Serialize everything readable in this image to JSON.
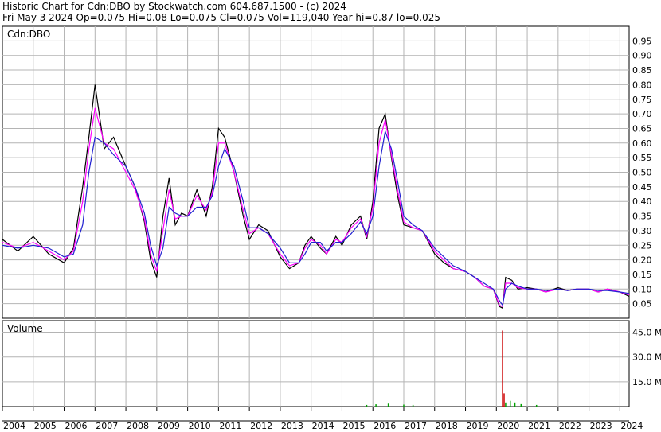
{
  "header": {
    "line1": "Historic Chart for Cdn:DBO by Stockwatch.com 604.687.1500 - (c) 2024",
    "line2": "Fri May  3 2024   Op=0.075   Hi=0.08   Lo=0.075   Cl=0.075   Vol=119,040   Year hi=0.87   lo=0.025"
  },
  "colors": {
    "price": "#000000",
    "ma_short": "#ff00ff",
    "ma_long": "#2020d0",
    "volume": "#cc0000",
    "volume_up": "#00a000",
    "grid": "#b4b4b4",
    "background": "#ffffff"
  },
  "chart_data": [
    {
      "type": "line",
      "legend": "Cdn:DBO",
      "ylim": [
        0,
        1.0
      ],
      "y_ticks": [
        "0.05",
        "0.10",
        "0.15",
        "0.20",
        "0.25",
        "0.30",
        "0.35",
        "0.40",
        "0.45",
        "0.50",
        "0.55",
        "0.60",
        "0.65",
        "0.70",
        "0.75",
        "0.80",
        "0.85",
        "0.90",
        "0.95"
      ],
      "grid": true,
      "x": [
        2004.0,
        2004.5,
        2005.0,
        2005.5,
        2006.0,
        2006.3,
        2006.6,
        2006.8,
        2007.0,
        2007.3,
        2007.6,
        2008.0,
        2008.3,
        2008.6,
        2008.8,
        2009.0,
        2009.2,
        2009.4,
        2009.6,
        2009.8,
        2010.0,
        2010.3,
        2010.6,
        2010.8,
        2011.0,
        2011.2,
        2011.5,
        2011.8,
        2012.0,
        2012.3,
        2012.6,
        2013.0,
        2013.3,
        2013.6,
        2013.8,
        2014.0,
        2014.3,
        2014.5,
        2014.8,
        2015.0,
        2015.3,
        2015.6,
        2015.8,
        2016.0,
        2016.2,
        2016.4,
        2016.6,
        2016.8,
        2017.0,
        2017.3,
        2017.6,
        2018.0,
        2018.3,
        2018.6,
        2019.0,
        2019.3,
        2019.6,
        2019.9,
        2020.1,
        2020.2,
        2020.3,
        2020.5,
        2020.7,
        2021.0,
        2021.3,
        2021.6,
        2022.0,
        2022.3,
        2022.6,
        2023.0,
        2023.3,
        2023.6,
        2024.0,
        2024.3
      ],
      "series": [
        {
          "values": [
            0.27,
            0.23,
            0.28,
            0.22,
            0.19,
            0.24,
            0.45,
            0.62,
            0.8,
            0.58,
            0.62,
            0.52,
            0.45,
            0.33,
            0.2,
            0.14,
            0.35,
            0.48,
            0.32,
            0.36,
            0.35,
            0.44,
            0.35,
            0.45,
            0.65,
            0.62,
            0.5,
            0.35,
            0.27,
            0.32,
            0.3,
            0.21,
            0.17,
            0.19,
            0.25,
            0.28,
            0.24,
            0.22,
            0.28,
            0.25,
            0.32,
            0.35,
            0.27,
            0.4,
            0.65,
            0.7,
            0.55,
            0.42,
            0.32,
            0.31,
            0.3,
            0.22,
            0.19,
            0.17,
            0.16,
            0.14,
            0.11,
            0.1,
            0.04,
            0.035,
            0.14,
            0.13,
            0.1,
            0.105,
            0.1,
            0.09,
            0.105,
            0.095,
            0.1,
            0.1,
            0.09,
            0.1,
            0.09,
            0.075
          ]
        },
        {
          "values": [
            0.26,
            0.24,
            0.26,
            0.23,
            0.2,
            0.23,
            0.4,
            0.58,
            0.72,
            0.6,
            0.58,
            0.5,
            0.44,
            0.34,
            0.22,
            0.16,
            0.3,
            0.44,
            0.34,
            0.35,
            0.35,
            0.42,
            0.37,
            0.43,
            0.6,
            0.6,
            0.5,
            0.37,
            0.29,
            0.31,
            0.29,
            0.22,
            0.18,
            0.19,
            0.24,
            0.27,
            0.25,
            0.22,
            0.27,
            0.26,
            0.31,
            0.34,
            0.28,
            0.38,
            0.6,
            0.68,
            0.56,
            0.44,
            0.33,
            0.31,
            0.3,
            0.23,
            0.2,
            0.17,
            0.16,
            0.14,
            0.11,
            0.1,
            0.045,
            0.04,
            0.12,
            0.12,
            0.105,
            0.1,
            0.1,
            0.09,
            0.1,
            0.095,
            0.1,
            0.1,
            0.09,
            0.1,
            0.09,
            0.08
          ]
        },
        {
          "values": [
            0.25,
            0.24,
            0.25,
            0.24,
            0.21,
            0.22,
            0.32,
            0.5,
            0.62,
            0.6,
            0.56,
            0.52,
            0.45,
            0.36,
            0.25,
            0.18,
            0.24,
            0.38,
            0.36,
            0.35,
            0.35,
            0.38,
            0.38,
            0.42,
            0.52,
            0.58,
            0.52,
            0.4,
            0.31,
            0.31,
            0.29,
            0.24,
            0.19,
            0.19,
            0.22,
            0.26,
            0.26,
            0.23,
            0.26,
            0.26,
            0.29,
            0.33,
            0.29,
            0.35,
            0.52,
            0.64,
            0.58,
            0.47,
            0.35,
            0.32,
            0.3,
            0.24,
            0.21,
            0.18,
            0.16,
            0.14,
            0.12,
            0.1,
            0.06,
            0.045,
            0.1,
            0.12,
            0.11,
            0.1,
            0.1,
            0.095,
            0.1,
            0.095,
            0.1,
            0.1,
            0.095,
            0.095,
            0.09,
            0.085
          ]
        }
      ]
    },
    {
      "type": "bar",
      "title": "Volume",
      "y_ticks": [
        "15.0 M",
        "30.0 M",
        "45.0 M"
      ],
      "ylim": [
        0,
        52
      ],
      "grid": true,
      "x": [
        2015.8,
        2016.1,
        2016.5,
        2017.0,
        2017.3,
        2020.2,
        2020.25,
        2020.3,
        2020.45,
        2020.6,
        2020.8,
        2021.3
      ],
      "values": [
        1.0,
        1.4,
        1.8,
        1.2,
        1.0,
        46.0,
        8.0,
        2.5,
        3.5,
        2.5,
        1.5,
        1.0
      ],
      "x_ticks": [
        "2004",
        "2005",
        "2006",
        "2007",
        "2008",
        "2009",
        "2010",
        "2011",
        "2012",
        "2013",
        "2014",
        "2015",
        "2016",
        "2017",
        "2018",
        "2019",
        "2020",
        "2021",
        "2022",
        "2023",
        "2024"
      ]
    }
  ]
}
